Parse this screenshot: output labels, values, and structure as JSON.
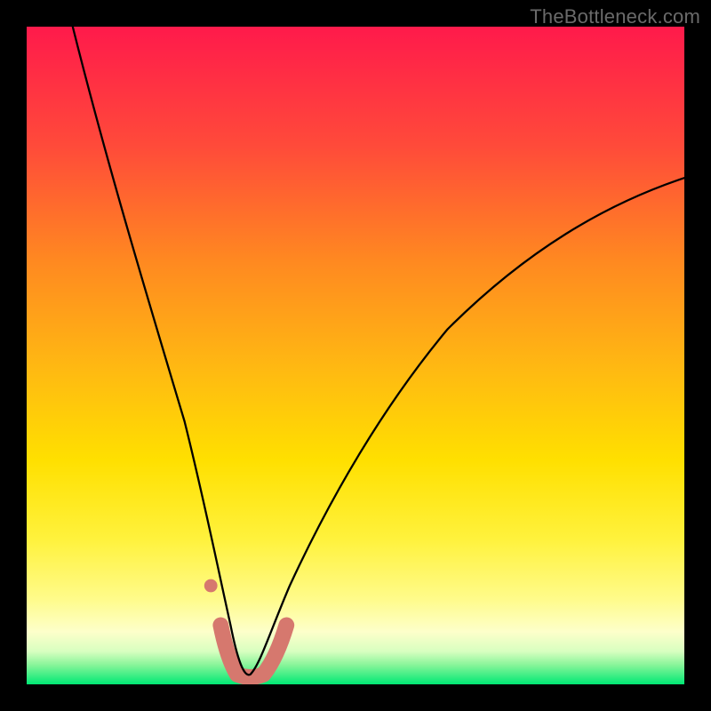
{
  "watermark": "TheBottleneck.com",
  "chart_data": {
    "type": "line",
    "title": "",
    "xlabel": "",
    "ylabel": "",
    "xlim": [
      0,
      100
    ],
    "ylim": [
      0,
      100
    ],
    "grid": false,
    "legend": false,
    "background_gradient": {
      "top_color": "#ff1a4b",
      "mid_colors": [
        "#ff6a2a",
        "#ffb912",
        "#ffe000",
        "#fff23d",
        "#fffec2"
      ],
      "bottom_color": "#00e874"
    },
    "curve_remark": "V-shaped bottleneck curve; minimum near x≈33, y≈0",
    "series": [
      {
        "name": "bottleneck_curve_black",
        "color": "#000000",
        "stroke_width": 2.3,
        "x": [
          7,
          10,
          14,
          18,
          22,
          26,
          29,
          31,
          33,
          35,
          38,
          44,
          52,
          62,
          74,
          88,
          100
        ],
        "y": [
          100,
          88,
          74,
          60,
          45,
          30,
          18,
          9,
          2,
          6,
          13,
          25,
          38,
          50,
          61,
          70,
          77
        ]
      },
      {
        "name": "highlight_bottom_pink",
        "color": "#d6786e",
        "stroke_width": 18,
        "x": [
          29.5,
          30.5,
          32,
          34,
          36,
          38,
          39.5
        ],
        "y": [
          9,
          4,
          1.5,
          1,
          1.5,
          4,
          9
        ]
      },
      {
        "name": "highlight_dot_left",
        "color": "#d6786e",
        "type_hint": "dot",
        "x": [
          28
        ],
        "y": [
          15
        ],
        "r": 7
      }
    ]
  }
}
